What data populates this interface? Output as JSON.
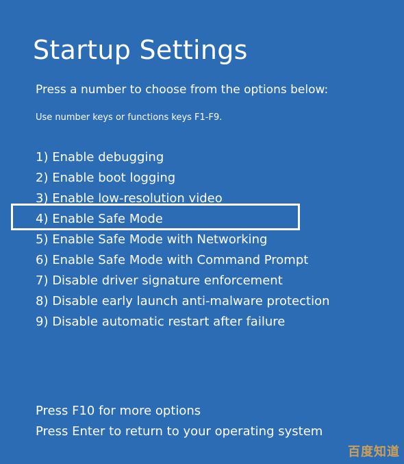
{
  "title": "Startup Settings",
  "subtitle": "Press a number to choose from the options below:",
  "hint": "Use number keys or functions keys F1-F9.",
  "options": [
    {
      "label": "1) Enable debugging"
    },
    {
      "label": "2) Enable boot logging"
    },
    {
      "label": "3) Enable low-resolution video"
    },
    {
      "label": "4) Enable Safe Mode",
      "selected": true
    },
    {
      "label": "5) Enable Safe Mode with Networking"
    },
    {
      "label": "6) Enable Safe Mode with Command Prompt"
    },
    {
      "label": "7) Disable driver signature enforcement"
    },
    {
      "label": "8) Disable early launch anti-malware protection"
    },
    {
      "label": "9) Disable automatic restart after failure"
    }
  ],
  "footer": {
    "more_options": "Press F10 for more options",
    "return": "Press Enter to return to your operating system"
  },
  "watermark": "百度知道",
  "colors": {
    "background": "#2b6cb5",
    "text": "#ffffff",
    "selection_border": "#ffffff"
  }
}
